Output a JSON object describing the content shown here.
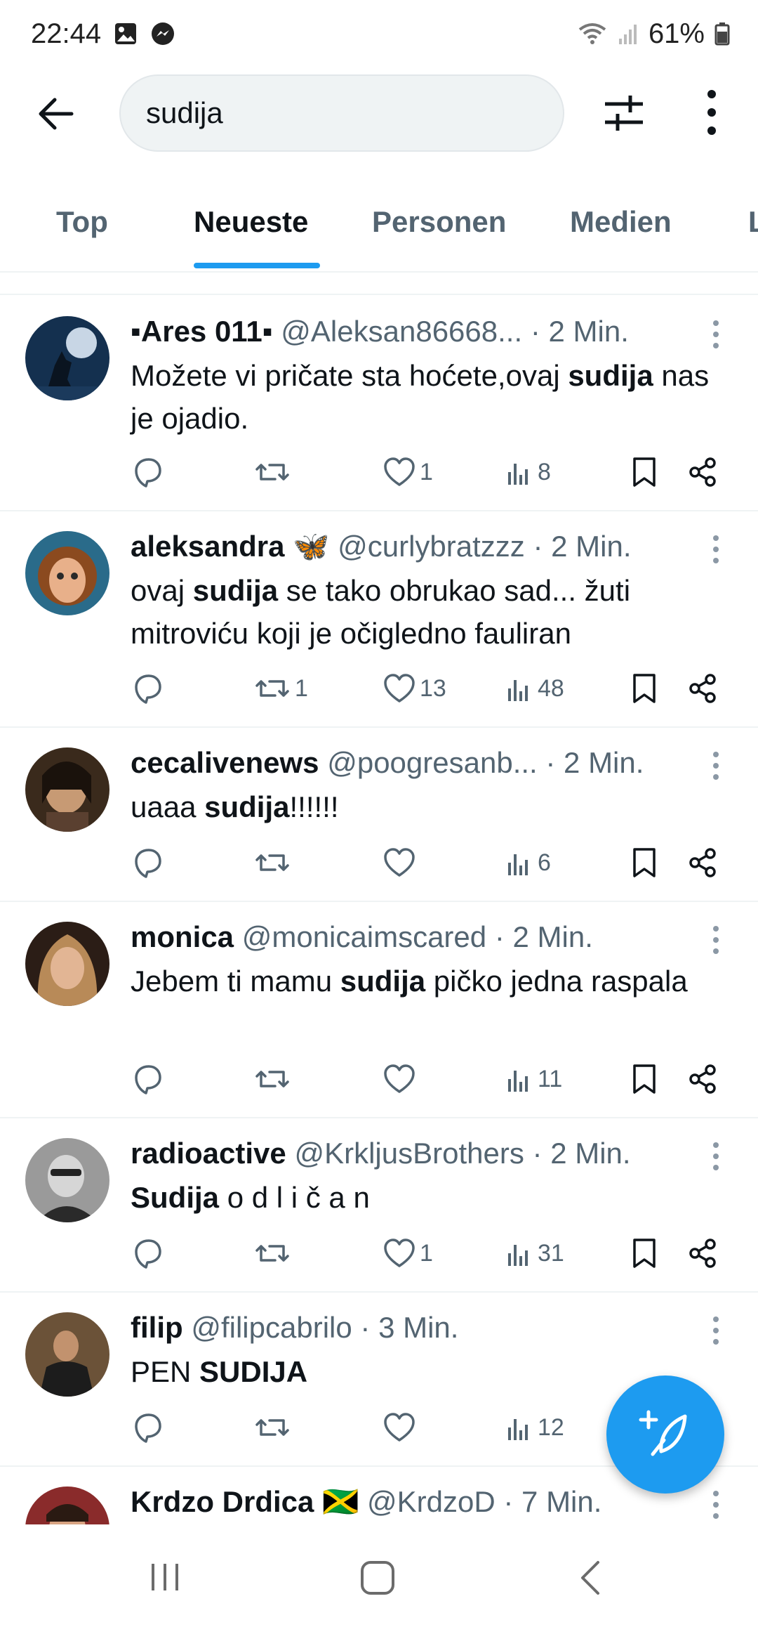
{
  "status_bar": {
    "time": "22:44",
    "battery": "61%"
  },
  "search": {
    "query": "sudija"
  },
  "tabs": [
    {
      "label": "Top",
      "active": false
    },
    {
      "label": "Neueste",
      "active": true
    },
    {
      "label": "Personen",
      "active": false
    },
    {
      "label": "Medien",
      "active": false
    },
    {
      "label": "L",
      "active": false
    }
  ],
  "tweets": [
    {
      "name": "▪Ares 011▪",
      "handle": "@Aleksan86668...",
      "sep": "·",
      "time": "2 Min.",
      "text_parts": [
        "Možete vi pričate sta hoćete,ovaj ",
        "sudija",
        " nas je ojadio."
      ],
      "replies": "",
      "retweets": "",
      "likes": "1",
      "views": "8"
    },
    {
      "name": "aleksandra",
      "emoji": "🦋",
      "handle": "@curlybratzzz",
      "sep": "·",
      "time": "2 Min.",
      "text_parts": [
        "ovaj ",
        "sudija",
        " se tako obrukao sad... žuti mitroviću koji je očigledno fauliran"
      ],
      "replies": "",
      "retweets": "1",
      "likes": "13",
      "views": "48"
    },
    {
      "name": "cecalivenews",
      "handle": "@poogresanb...",
      "sep": "·",
      "time": "2 Min.",
      "text_parts": [
        "uaaa ",
        "sudija",
        "!!!!!!"
      ],
      "replies": "",
      "retweets": "",
      "likes": "",
      "views": "6"
    },
    {
      "name": "monica",
      "handle": "@monicaimscared",
      "sep": "·",
      "time": "2 Min.",
      "text_parts": [
        "Jebem ti mamu ",
        "sudija",
        " pičko jedna raspala"
      ],
      "replies": "",
      "retweets": "",
      "likes": "",
      "views": "11"
    },
    {
      "name": "radioactive",
      "handle": "@KrkljusBrothers",
      "sep": "·",
      "time": "2 Min.",
      "text_parts": [
        "",
        "Sudija",
        " o d l i č a n"
      ],
      "replies": "",
      "retweets": "",
      "likes": "1",
      "views": "31"
    },
    {
      "name": "filip",
      "handle": "@filipcabrilo",
      "sep": "·",
      "time": "3 Min.",
      "text_parts": [
        "PEN ",
        "SUDIJA",
        ""
      ],
      "replies": "",
      "retweets": "",
      "likes": "",
      "views": "12"
    },
    {
      "name": "Krdzo Drdica",
      "emoji": "🇯🇲",
      "handle": "@KrdzoD",
      "sep": "·",
      "time": "7 Min."
    }
  ],
  "icons": {
    "back": "arrow-left-icon",
    "filter": "sliders-icon",
    "more": "more-vertical-icon",
    "compose": "feather-plus-icon",
    "reply": "reply-icon",
    "retweet": "retweet-icon",
    "like": "heart-icon",
    "views": "views-icon",
    "bookmark": "bookmark-icon",
    "share": "share-icon"
  },
  "colors": {
    "accent": "#1d9bf0",
    "secondary_text": "#536471",
    "primary_text": "#0f1419"
  }
}
